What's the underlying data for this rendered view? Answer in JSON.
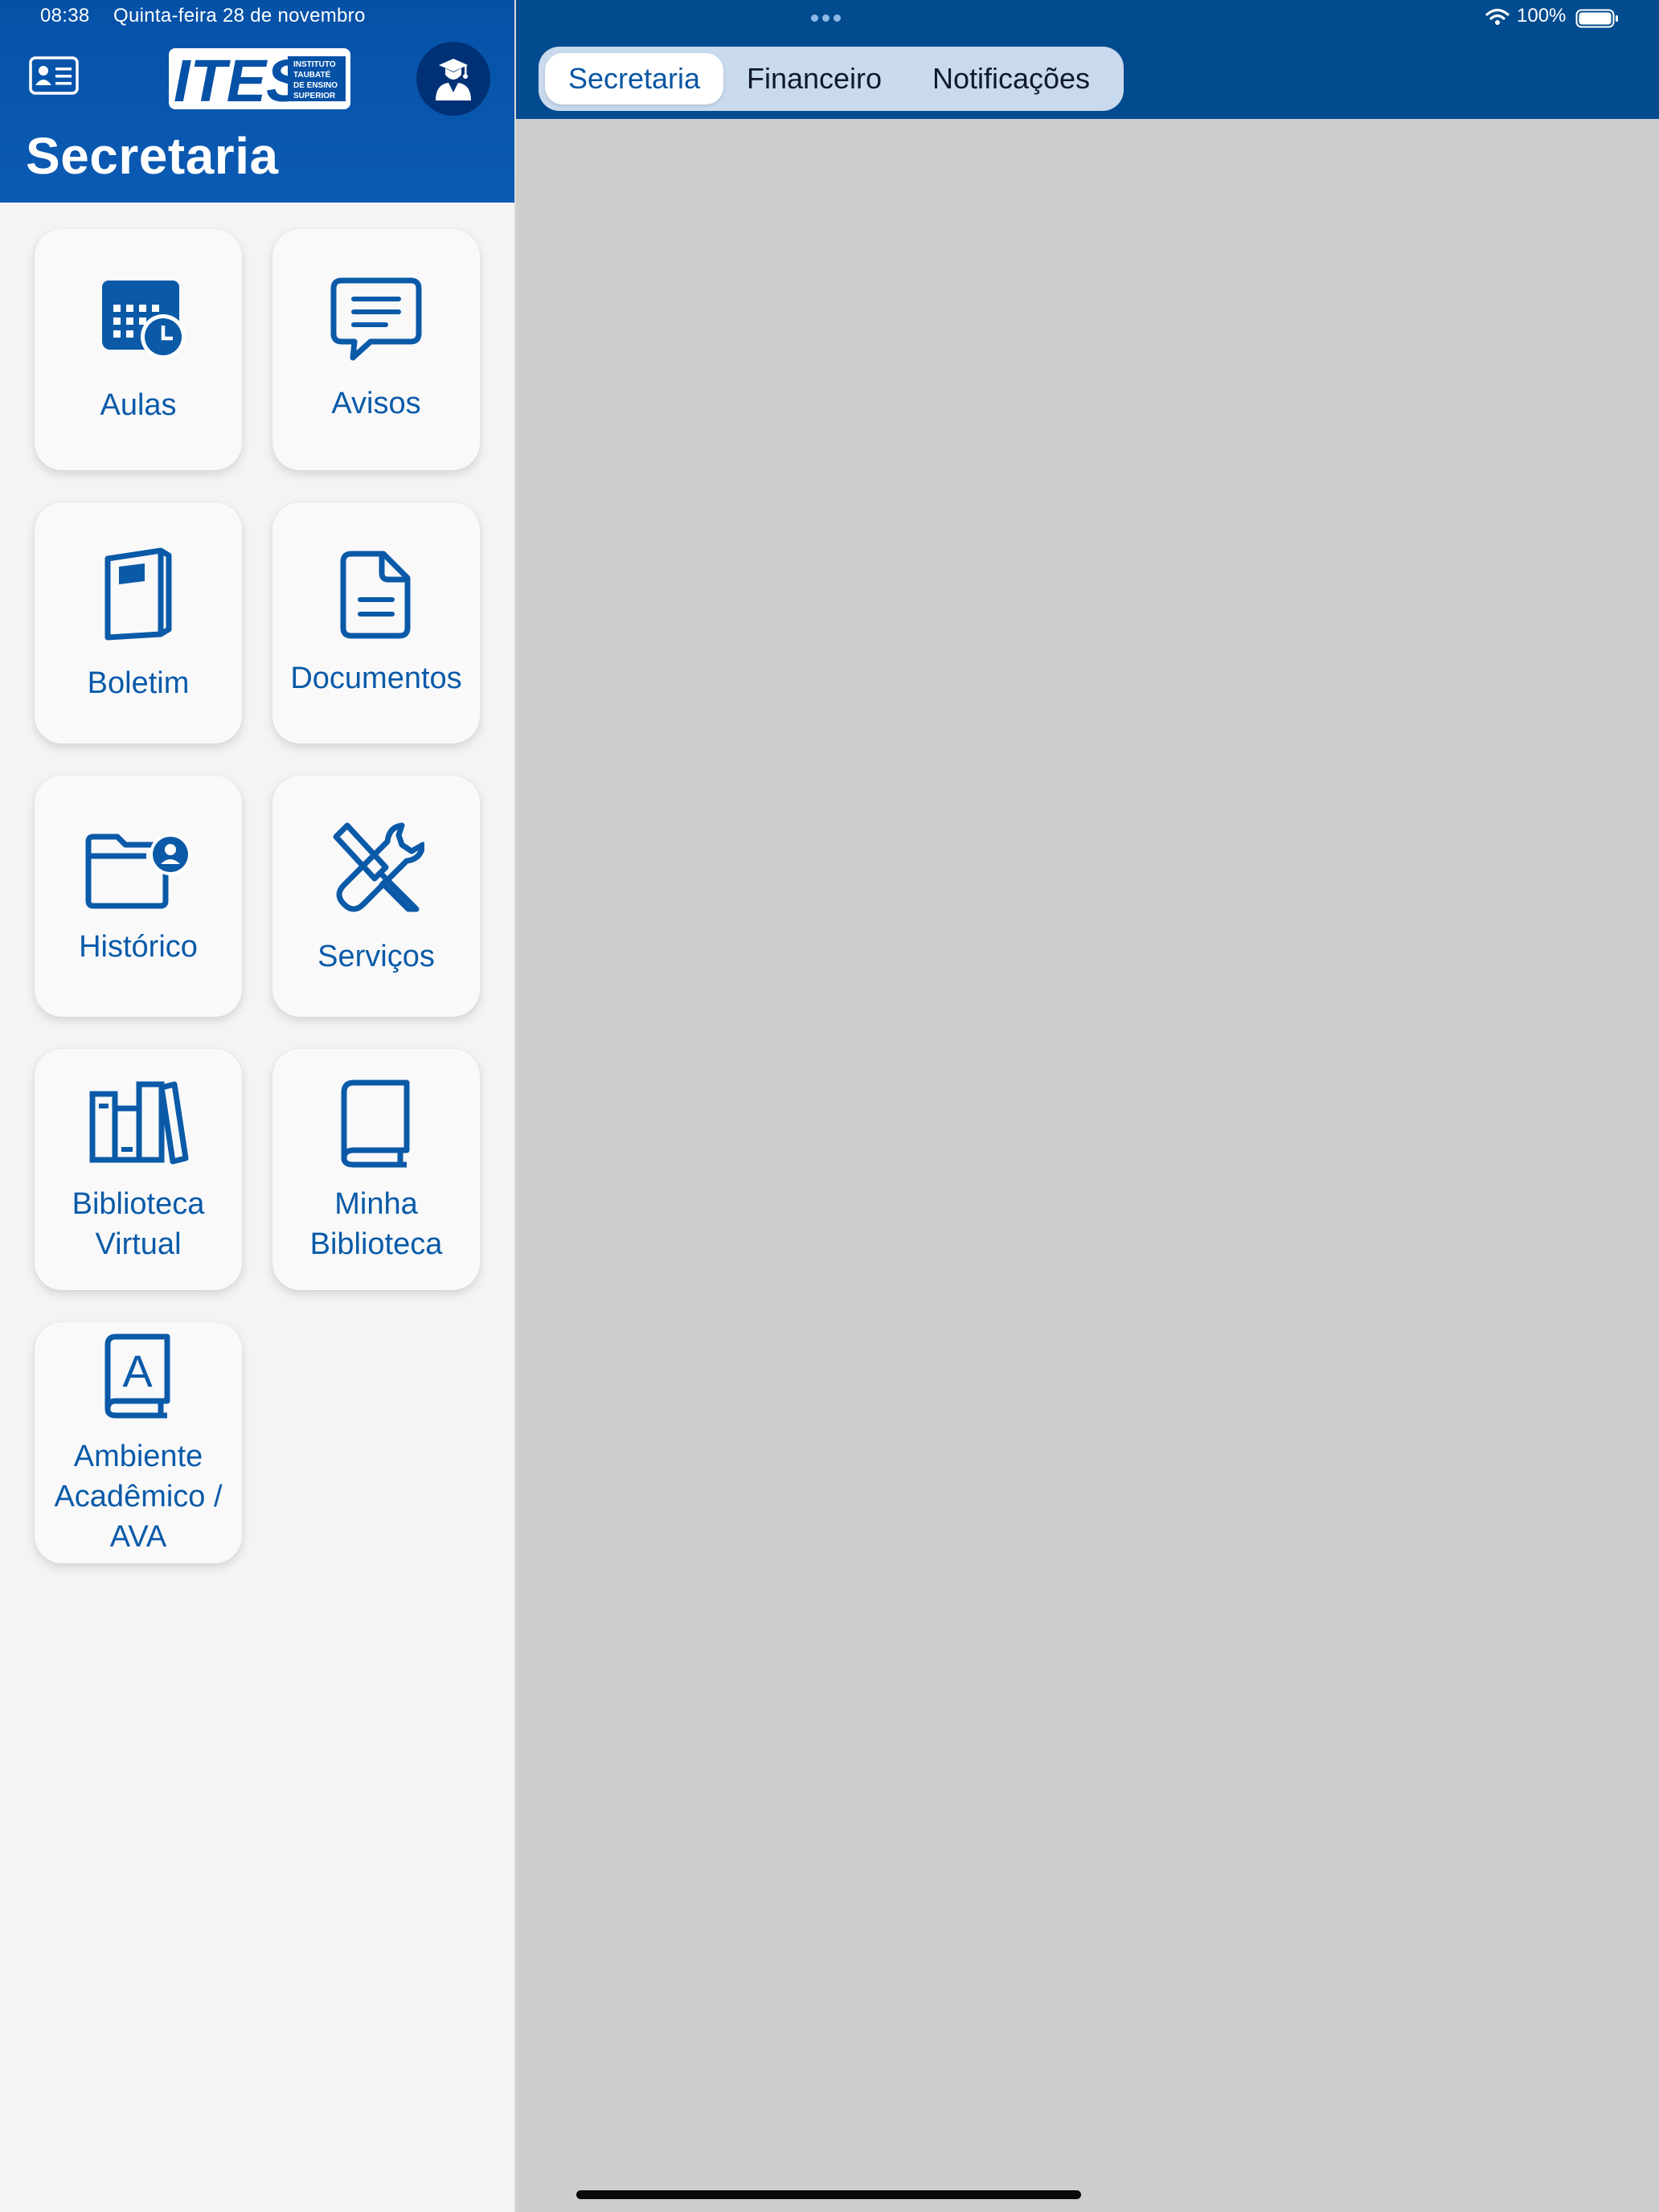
{
  "status_bar": {
    "time": "08:38",
    "date": "Quinta-feira 28 de novembro",
    "battery": "100%"
  },
  "sidebar": {
    "logo_text": "ITES",
    "logo_subtitle": "INSTITUTO TAUBATÉ DE ENSINO SUPERIOR",
    "title": "Secretaria",
    "tiles": [
      {
        "label": "Aulas",
        "icon": "calendar-clock-icon"
      },
      {
        "label": "Avisos",
        "icon": "message-bubble-icon"
      },
      {
        "label": "Boletim",
        "icon": "notebook-icon"
      },
      {
        "label": "Documentos",
        "icon": "document-icon"
      },
      {
        "label": "Histórico",
        "icon": "folder-user-icon"
      },
      {
        "label": "Serviços",
        "icon": "tools-icon"
      },
      {
        "label": "Biblioteca\nVirtual",
        "icon": "bookshelf-icon"
      },
      {
        "label": "Minha\nBiblioteca",
        "icon": "book-icon"
      },
      {
        "label": "Ambiente\nAcadêmico /\nAVA",
        "icon": "book-letter-icon"
      }
    ]
  },
  "tabs": [
    {
      "label": "Secretaria",
      "active": true
    },
    {
      "label": "Financeiro",
      "active": false
    },
    {
      "label": "Notificações",
      "active": false
    }
  ],
  "colors": {
    "brand_blue": "#0551a6",
    "header_blue": "#024b8e",
    "icon_blue": "#0a5aa8",
    "detail_bg": "#cdcdcd"
  }
}
